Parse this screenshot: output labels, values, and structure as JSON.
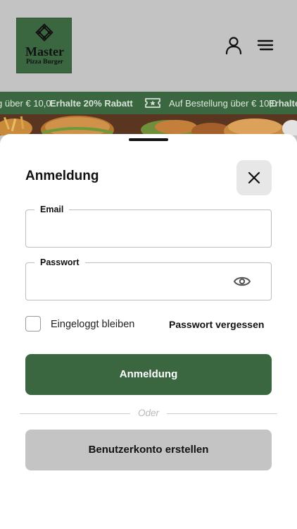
{
  "header": {
    "logo": {
      "line1": "Master",
      "line2": "Pizza Burger",
      "colors": {
        "background": "#3a6740",
        "text": "#111111"
      }
    },
    "icons": {
      "account": "user-icon",
      "menu": "hamburger-menu-icon"
    }
  },
  "promo_ticker": {
    "items": [
      "g über € 10,0",
      "Erhalte 20% Rabatt",
      "Auf Bestellung über € 10,0",
      "Erhalte"
    ],
    "icon": "ticket-star-icon"
  },
  "login_sheet": {
    "title": "Anmeldung",
    "email": {
      "label": "Email",
      "value": "",
      "placeholder": ""
    },
    "password": {
      "label": "Passwort",
      "value": "",
      "placeholder": ""
    },
    "remember_me": {
      "label": "Eingeloggt bleiben",
      "checked": false
    },
    "forgot_password": "Passwort vergessen",
    "login_button": "Anmeldung",
    "divider_text": "Oder",
    "register_button": "Benutzerkonto erstellen"
  },
  "colors": {
    "brand_green": "#3a6740",
    "secondary_button": "#c4c4c4",
    "overlay_gray": "#c3c3c3"
  }
}
